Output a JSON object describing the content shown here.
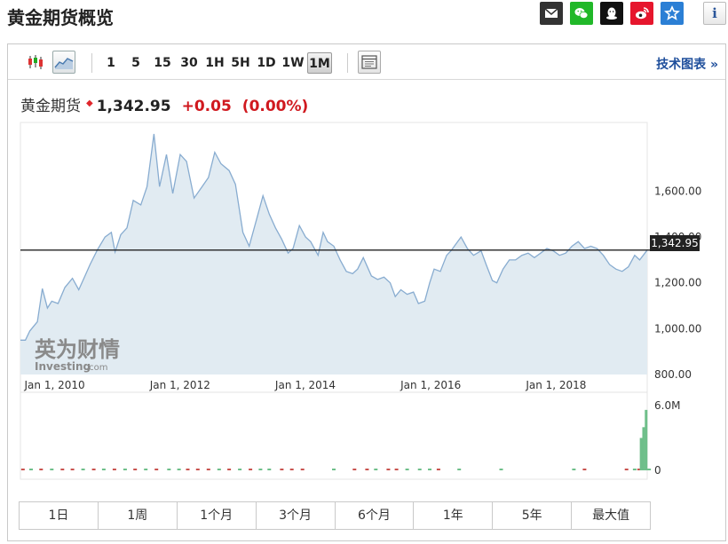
{
  "page": {
    "title": "黄金期货概览"
  },
  "share": {
    "buttons": [
      {
        "name": "email-share-button",
        "icon": "mail-icon",
        "color": "#333333"
      },
      {
        "name": "wechat-share-button",
        "icon": "wechat-icon",
        "color": "#21b829"
      },
      {
        "name": "qq-share-button",
        "icon": "qq-icon",
        "color": "#111111"
      },
      {
        "name": "weibo-share-button",
        "icon": "weibo-icon",
        "color": "#e6162d"
      },
      {
        "name": "favorite-button",
        "icon": "star-icon",
        "color": "#2b7fd5"
      }
    ],
    "info": "i"
  },
  "toolbar": {
    "periods": [
      "1",
      "5",
      "15",
      "30",
      "1H",
      "5H",
      "1D",
      "1W",
      "1M"
    ],
    "active_period": "1M",
    "tech_chart_link": "技术图表 »"
  },
  "quote": {
    "name": "黄金期货",
    "price": "1,342.95",
    "change": "+0.05",
    "change_pct": "(0.00%)",
    "up_color": "#d0191f"
  },
  "chart": {
    "current_price_label": "1,342.95",
    "watermark_top": "英为财情",
    "watermark_bottom": "Investing",
    "watermark_suffix": ".com",
    "fill_color": "#e1ebf2",
    "line_color": "#88acd0"
  },
  "chart_data": {
    "type": "area",
    "title": "",
    "ylim": [
      800,
      1900
    ],
    "y_ticks": [
      "1,600.00",
      "1,400.00",
      "1,200.00",
      "1,000.00",
      "800.00"
    ],
    "y_tick_values": [
      1600,
      1400,
      1200,
      1000,
      800
    ],
    "x_tick_labels": [
      "Jan 1, 2010",
      "Jan 1, 2012",
      "Jan 1, 2014",
      "Jan 1, 2016",
      "Jan 1, 2018"
    ],
    "x_tick_years": [
      2010,
      2012,
      2014,
      2016,
      2018
    ],
    "x_range": [
      2009.95,
      2019.95
    ],
    "reference_line": 1342.95,
    "series": [
      {
        "values": [
          [
            2009.95,
            950
          ],
          [
            2010.03,
            950
          ],
          [
            2010.1,
            990
          ],
          [
            2010.22,
            1030
          ],
          [
            2010.3,
            1175
          ],
          [
            2010.38,
            1090
          ],
          [
            2010.45,
            1120
          ],
          [
            2010.55,
            1110
          ],
          [
            2010.66,
            1180
          ],
          [
            2010.78,
            1220
          ],
          [
            2010.88,
            1170
          ],
          [
            2010.98,
            1230
          ],
          [
            2011.06,
            1280
          ],
          [
            2011.18,
            1345
          ],
          [
            2011.3,
            1400
          ],
          [
            2011.4,
            1420
          ],
          [
            2011.46,
            1335
          ],
          [
            2011.55,
            1410
          ],
          [
            2011.65,
            1440
          ],
          [
            2011.75,
            1560
          ],
          [
            2011.87,
            1540
          ],
          [
            2011.97,
            1620
          ],
          [
            2012.08,
            1850
          ],
          [
            2012.17,
            1620
          ],
          [
            2012.28,
            1760
          ],
          [
            2012.38,
            1590
          ],
          [
            2012.5,
            1760
          ],
          [
            2012.6,
            1730
          ],
          [
            2012.72,
            1570
          ],
          [
            2012.85,
            1620
          ],
          [
            2012.95,
            1660
          ],
          [
            2013.05,
            1770
          ],
          [
            2013.15,
            1720
          ],
          [
            2013.28,
            1690
          ],
          [
            2013.38,
            1630
          ],
          [
            2013.5,
            1420
          ],
          [
            2013.6,
            1360
          ],
          [
            2013.72,
            1480
          ],
          [
            2013.82,
            1580
          ],
          [
            2013.92,
            1500
          ],
          [
            2014.02,
            1440
          ],
          [
            2014.12,
            1390
          ],
          [
            2014.22,
            1330
          ],
          [
            2014.3,
            1350
          ],
          [
            2014.4,
            1450
          ],
          [
            2014.5,
            1400
          ],
          [
            2014.58,
            1380
          ],
          [
            2014.7,
            1320
          ],
          [
            2014.78,
            1420
          ],
          [
            2014.85,
            1380
          ],
          [
            2014.95,
            1360
          ],
          [
            2015.05,
            1300
          ],
          [
            2015.15,
            1250
          ],
          [
            2015.25,
            1240
          ],
          [
            2015.33,
            1260
          ],
          [
            2015.42,
            1310
          ],
          [
            2015.55,
            1230
          ],
          [
            2015.65,
            1215
          ],
          [
            2015.75,
            1225
          ],
          [
            2015.85,
            1200
          ],
          [
            2015.93,
            1140
          ],
          [
            2016.02,
            1170
          ],
          [
            2016.12,
            1150
          ],
          [
            2016.22,
            1160
          ],
          [
            2016.3,
            1110
          ],
          [
            2016.4,
            1120
          ],
          [
            2016.48,
            1200
          ],
          [
            2016.55,
            1260
          ],
          [
            2016.65,
            1250
          ],
          [
            2016.75,
            1320
          ],
          [
            2016.82,
            1340
          ],
          [
            2016.9,
            1370
          ],
          [
            2016.98,
            1400
          ],
          [
            2017.08,
            1350
          ],
          [
            2017.18,
            1320
          ],
          [
            2017.3,
            1340
          ],
          [
            2017.38,
            1280
          ],
          [
            2017.48,
            1210
          ],
          [
            2017.55,
            1200
          ],
          [
            2017.65,
            1260
          ],
          [
            2017.75,
            1300
          ],
          [
            2017.85,
            1300
          ],
          [
            2017.95,
            1320
          ],
          [
            2018.05,
            1330
          ],
          [
            2018.15,
            1310
          ],
          [
            2018.25,
            1330
          ],
          [
            2018.35,
            1350
          ],
          [
            2018.45,
            1340
          ],
          [
            2018.55,
            1320
          ],
          [
            2018.65,
            1330
          ],
          [
            2018.75,
            1360
          ],
          [
            2018.85,
            1380
          ],
          [
            2018.95,
            1350
          ],
          [
            2019.05,
            1360
          ],
          [
            2019.15,
            1350
          ],
          [
            2019.25,
            1320
          ],
          [
            2019.35,
            1280
          ],
          [
            2019.45,
            1260
          ],
          [
            2019.55,
            1250
          ],
          [
            2019.65,
            1270
          ],
          [
            2019.75,
            1320
          ],
          [
            2019.83,
            1300
          ],
          [
            2019.95,
            1342.95
          ]
        ]
      }
    ],
    "volume": {
      "ylim": [
        0,
        6000000
      ],
      "y_ticks": [
        "6.0M",
        "0"
      ],
      "y_tick_values": [
        6000000,
        0
      ],
      "bars": [
        [
          2009.99,
          -1
        ],
        [
          2010.12,
          1
        ],
        [
          2010.28,
          -1
        ],
        [
          2010.45,
          1
        ],
        [
          2010.62,
          -1
        ],
        [
          2010.78,
          -1
        ],
        [
          2010.95,
          1
        ],
        [
          2011.12,
          -1
        ],
        [
          2011.28,
          1
        ],
        [
          2011.45,
          -1
        ],
        [
          2011.62,
          1
        ],
        [
          2011.78,
          -1
        ],
        [
          2011.95,
          1
        ],
        [
          2012.12,
          -1
        ],
        [
          2012.32,
          1
        ],
        [
          2012.48,
          1
        ],
        [
          2012.62,
          -1
        ],
        [
          2012.78,
          -1
        ],
        [
          2012.95,
          -1
        ],
        [
          2013.12,
          1
        ],
        [
          2013.28,
          -1
        ],
        [
          2013.45,
          1
        ],
        [
          2013.62,
          -1
        ],
        [
          2013.78,
          1
        ],
        [
          2013.92,
          1
        ],
        [
          2014.12,
          -1
        ],
        [
          2014.28,
          -1
        ],
        [
          2014.45,
          -1
        ],
        [
          2014.95,
          1
        ],
        [
          2015.28,
          -1
        ],
        [
          2015.48,
          -1
        ],
        [
          2015.62,
          1
        ],
        [
          2015.82,
          -1
        ],
        [
          2015.95,
          -1
        ],
        [
          2016.12,
          1
        ],
        [
          2016.32,
          1
        ],
        [
          2016.48,
          1
        ],
        [
          2016.62,
          -1
        ],
        [
          2016.95,
          1
        ],
        [
          2017.62,
          1
        ],
        [
          2018.78,
          1
        ],
        [
          2018.95,
          -1
        ],
        [
          2019.62,
          -1
        ],
        [
          2019.75,
          1
        ],
        [
          2019.82,
          -1
        ],
        [
          2019.86,
          3
        ],
        [
          2019.9,
          4
        ],
        [
          2019.94,
          5.6
        ],
        [
          2019.98,
          1
        ]
      ]
    }
  },
  "ranges": [
    "1日",
    "1周",
    "1个月",
    "3个月",
    "6个月",
    "1年",
    "5年",
    "最大值"
  ]
}
